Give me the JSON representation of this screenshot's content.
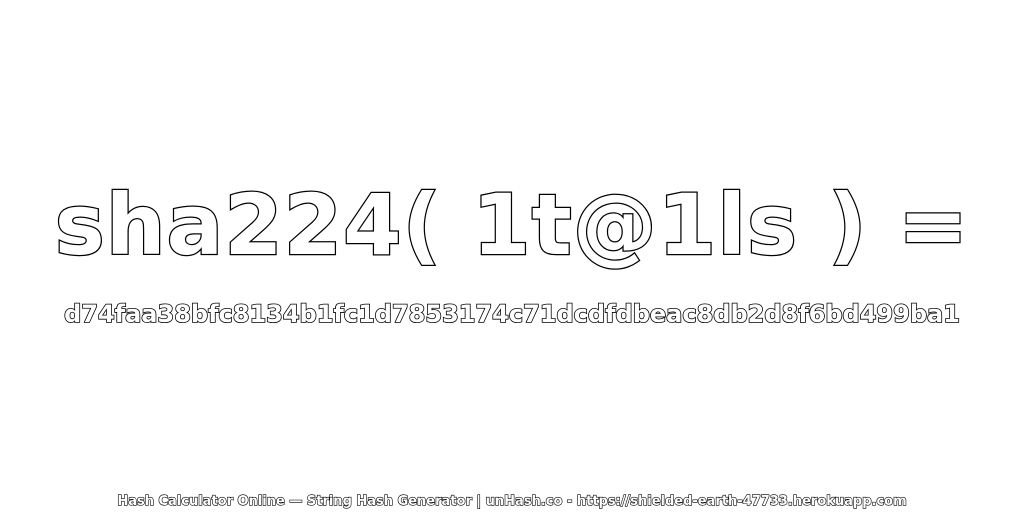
{
  "expression": "sha224( 1t@1ls ) =",
  "hash_output": "d74faa38bfc8134b1fc1d7853174c71dcdfdbeac8db2d8f6bd499ba1",
  "footer": "Hash Calculator Online — String Hash Generator | unHash.co - https://shielded-earth-47733.herokuapp.com",
  "colors": {
    "background": "#ffffff",
    "text_fill": "#ffffff",
    "text_outline": "#000000"
  }
}
